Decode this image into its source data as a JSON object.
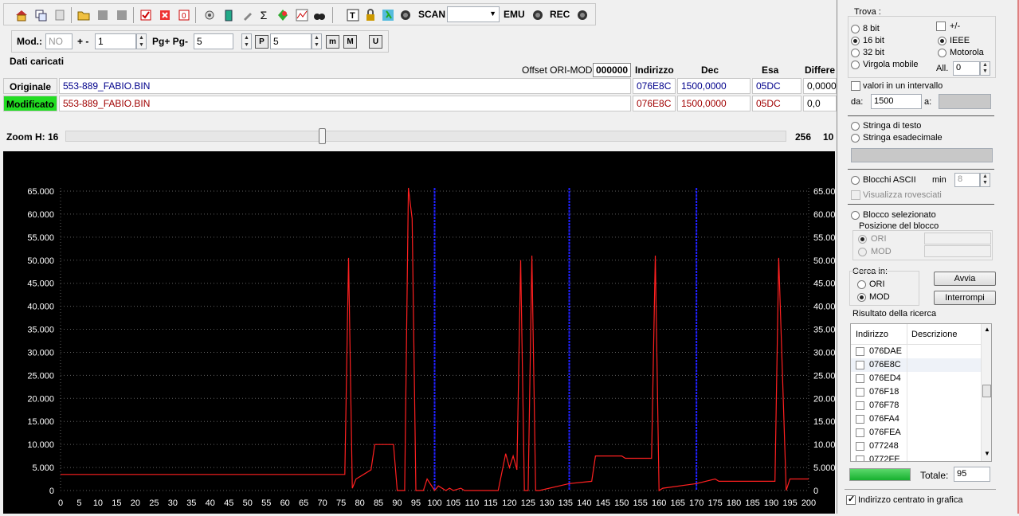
{
  "toolbar": {
    "scan_label": "SCAN",
    "emu_label": "EMU",
    "rec_label": "REC"
  },
  "toolbar2": {
    "mod_label": "Mod.:",
    "mod_value": "NO",
    "plusminus_label": "+ -",
    "plusminus_value": "1",
    "pg_label": "Pg+ Pg-",
    "pg_value": "5",
    "p_value": "5"
  },
  "files": {
    "frame_title": "Dati caricati",
    "offset_label": "Offset ORI-MOD",
    "offset_value": "000000",
    "col_indirizzo": "Indirizzo",
    "col_dec": "Dec",
    "col_esa": "Esa",
    "col_diff": "Differe",
    "original": {
      "label": "Originale",
      "name": "553-889_FABIO.BIN",
      "addr": "076E8C",
      "dec": "1500,0000",
      "hex": "05DC",
      "diff": "0,0000"
    },
    "modified": {
      "label": "Modificato",
      "name": "553-889_FABIO.BIN",
      "addr": "076E8C",
      "dec": "1500,0000",
      "hex": "05DC",
      "diff": "0,0"
    }
  },
  "zoom": {
    "label": "Zoom H: 16",
    "max_label": "256",
    "extra_label": "10",
    "slider_position": 0.5
  },
  "search_panel": {
    "trova_label": "Trova :",
    "opt_8bit": "8 bit",
    "opt_16bit": "16 bit",
    "opt_32bit": "32 bit",
    "opt_float": "Virgola mobile",
    "opt_plusminus": "+/-",
    "opt_ieee": "IEEE",
    "opt_motorola": "Motorola",
    "all_label": "All.",
    "all_value": "0",
    "range_label": "valori in un intervallo",
    "da_label": "da:",
    "da_value": "1500",
    "a_label": "a:",
    "text_string": "Stringa di testo",
    "hex_string": "Stringa esadecimale",
    "ascii_blocks": "Blocchi ASCII",
    "min_label": "min",
    "min_value": "8",
    "show_reversed": "Visualizza rovesciati",
    "selected_block": "Blocco selezionato",
    "block_position": "Posizione del blocco",
    "ori_label": "ORI",
    "mod_label": "MOD",
    "search_in": "Cerca in:",
    "search_ori": "ORI",
    "search_mod": "MOD",
    "start_button": "Avvia",
    "stop_button": "Interrompi",
    "results_label": "Risultato della ricerca",
    "col_address": "Indirizzo",
    "col_description": "Descrizione",
    "results": [
      "076DAE",
      "076E8C",
      "076ED4",
      "076F18",
      "076F78",
      "076FA4",
      "076FEA",
      "077248",
      "0772FE"
    ],
    "total_label": "Totale:",
    "total_value": "95",
    "centered_label": "Indirizzo centrato in grafica"
  },
  "chart_data": {
    "type": "line",
    "title": "",
    "xlabel": "",
    "ylabel": "",
    "xlim": [
      0,
      200
    ],
    "ylim": [
      0,
      65000
    ],
    "x_ticks": [
      0,
      5,
      10,
      15,
      20,
      25,
      30,
      35,
      40,
      45,
      50,
      55,
      60,
      65,
      70,
      75,
      80,
      85,
      90,
      95,
      100,
      105,
      110,
      115,
      120,
      125,
      130,
      135,
      140,
      145,
      150,
      155,
      160,
      165,
      170,
      175,
      180,
      185,
      190,
      195,
      200
    ],
    "y_tick_labels": [
      "0",
      "5.000",
      "10.000",
      "15.000",
      "20.000",
      "25.000",
      "30.000",
      "35.000",
      "40.000",
      "45.000",
      "50.000",
      "55.000",
      "60.000",
      "65.000"
    ],
    "y_ticks": [
      0,
      5000,
      10000,
      15000,
      20000,
      25000,
      30000,
      35000,
      40000,
      45000,
      50000,
      55000,
      60000,
      65000
    ],
    "grid": true,
    "colors": {
      "background": "#000000",
      "series": "#ff2020",
      "markers": "#2020ff",
      "grid": "#606060"
    },
    "vertical_markers_x": [
      100,
      136,
      170
    ],
    "series": [
      {
        "points": [
          [
            0,
            3500
          ],
          [
            76,
            3500
          ],
          [
            77,
            50500
          ],
          [
            78,
            500
          ],
          [
            79,
            2500
          ],
          [
            81,
            3500
          ],
          [
            83,
            4500
          ],
          [
            84,
            10000
          ],
          [
            89,
            10000
          ],
          [
            90,
            0
          ],
          [
            92,
            0
          ],
          [
            93,
            66000
          ],
          [
            94,
            59000
          ],
          [
            95,
            0
          ],
          [
            97,
            0
          ],
          [
            98,
            2500
          ],
          [
            100,
            0
          ],
          [
            101,
            1000
          ],
          [
            103,
            0
          ],
          [
            104,
            500
          ],
          [
            105,
            0
          ],
          [
            107,
            500
          ],
          [
            108,
            0
          ],
          [
            117,
            0
          ],
          [
            118,
            4000
          ],
          [
            119,
            8000
          ],
          [
            120,
            5000
          ],
          [
            121,
            7500
          ],
          [
            122,
            4500
          ],
          [
            123,
            50000
          ],
          [
            124,
            0
          ],
          [
            125,
            0
          ],
          [
            126,
            51000
          ],
          [
            127,
            0
          ],
          [
            128,
            0
          ],
          [
            136,
            1500
          ],
          [
            142,
            2000
          ],
          [
            143,
            7500
          ],
          [
            150,
            7500
          ],
          [
            151,
            7000
          ],
          [
            158,
            7000
          ],
          [
            159,
            51000
          ],
          [
            160,
            0
          ],
          [
            161,
            500
          ],
          [
            170,
            1500
          ],
          [
            175,
            2500
          ],
          [
            176,
            2000
          ],
          [
            191,
            2000
          ],
          [
            192,
            50500
          ],
          [
            194,
            0
          ],
          [
            195,
            2500
          ],
          [
            200,
            2500
          ]
        ]
      }
    ]
  }
}
